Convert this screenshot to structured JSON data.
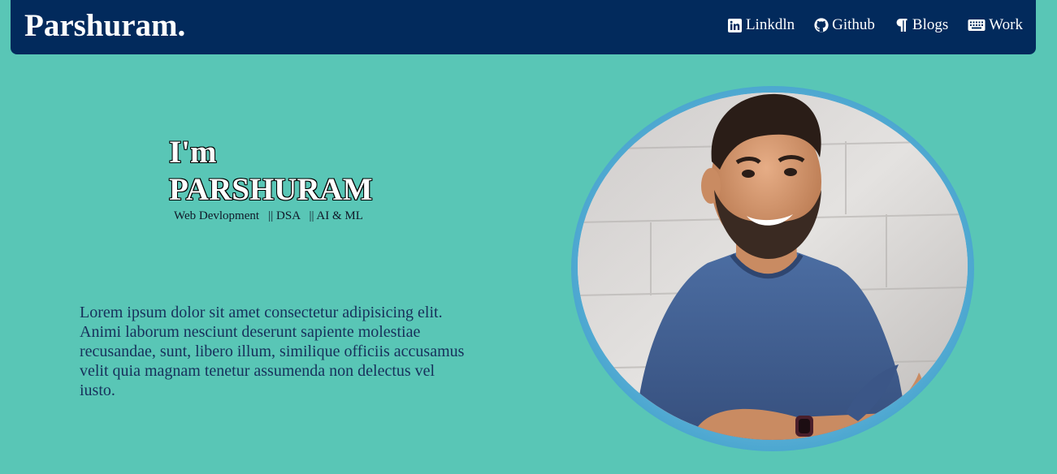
{
  "brand": {
    "name": "Parshuram."
  },
  "nav": {
    "items": [
      {
        "label": "Linkdln",
        "icon": "linkedin-icon"
      },
      {
        "label": "Github",
        "icon": "github-icon"
      },
      {
        "label": "Blogs",
        "icon": "paragraph-icon"
      },
      {
        "label": "Work",
        "icon": "keyboard-icon"
      }
    ]
  },
  "hero": {
    "greeting": "I'm",
    "name": "PARSHURAM",
    "skills": "Web Devlopment   || DSA   || AI & ML",
    "about": "Lorem ipsum dolor sit amet consectetur adipisicing elit. Animi laborum nesciunt deserunt sapiente molestiae recusandae, sunt, libero illum, similique officiis accusamus velit quia magnam tenetur assumenda non delectus vel iusto."
  },
  "colors": {
    "background": "#59c6b6",
    "navbar": "#022a5c",
    "ring": "#5aaed6",
    "about_text": "#17305b"
  }
}
